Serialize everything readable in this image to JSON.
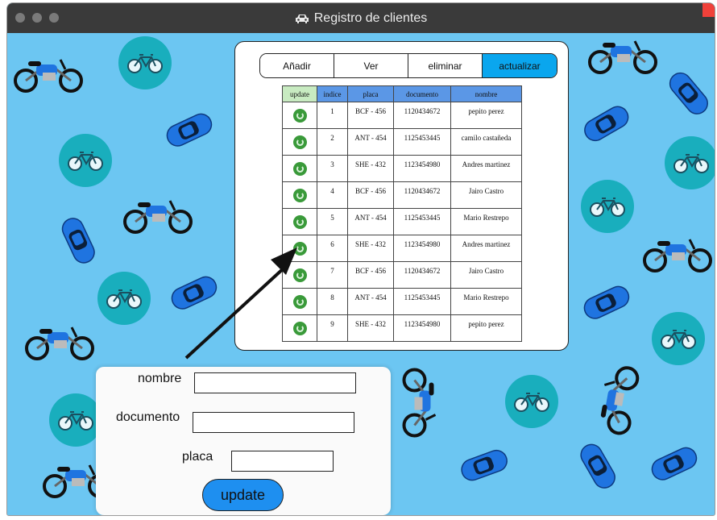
{
  "window": {
    "title": "Registro de clientes"
  },
  "tabs": [
    {
      "label": "Añadir",
      "active": false
    },
    {
      "label": "Ver",
      "active": false
    },
    {
      "label": "eliminar",
      "active": false
    },
    {
      "label": "actualizar",
      "active": true
    }
  ],
  "table": {
    "headers": [
      "update",
      "indice",
      "placa",
      "documento",
      "nombre"
    ],
    "rows": [
      {
        "indice": "1",
        "placa": "BCF - 456",
        "documento": "1120434672",
        "nombre": "pepito perez"
      },
      {
        "indice": "2",
        "placa": "ANT - 454",
        "documento": "1125453445",
        "nombre": "camilo castañeda"
      },
      {
        "indice": "3",
        "placa": "SHE - 432",
        "documento": "1123454980",
        "nombre": "Andres martinez"
      },
      {
        "indice": "4",
        "placa": "BCF - 456",
        "documento": "1120434672",
        "nombre": "Jairo Castro"
      },
      {
        "indice": "5",
        "placa": "ANT - 454",
        "documento": "1125453445",
        "nombre": "Mario Restrepo"
      },
      {
        "indice": "6",
        "placa": "SHE - 432",
        "documento": "1123454980",
        "nombre": "Andres martinez"
      },
      {
        "indice": "7",
        "placa": "BCF - 456",
        "documento": "1120434672",
        "nombre": "Jairo Castro"
      },
      {
        "indice": "8",
        "placa": "ANT - 454",
        "documento": "1125453445",
        "nombre": "Mario Restrepo"
      },
      {
        "indice": "9",
        "placa": "SHE - 432",
        "documento": "1123454980",
        "nombre": "pepito perez"
      }
    ]
  },
  "form": {
    "nombre_label": "nombre",
    "documento_label": "documento",
    "placa_label": "placa",
    "nombre_value": "",
    "documento_value": "",
    "placa_value": "",
    "submit_label": "update"
  },
  "icons": {
    "title": "car-icon",
    "row_action": "refresh-icon",
    "background": [
      "motorcycle-icon",
      "bicycle-icon",
      "car-icon"
    ]
  },
  "colors": {
    "background": "#6cc6f2",
    "tab_active": "#0aa6ee",
    "header": "#5b97e6",
    "update_header": "#c8ebc1",
    "button": "#1e8ff0",
    "bike_badge": "#19aebd",
    "car": "#1f74e0"
  }
}
